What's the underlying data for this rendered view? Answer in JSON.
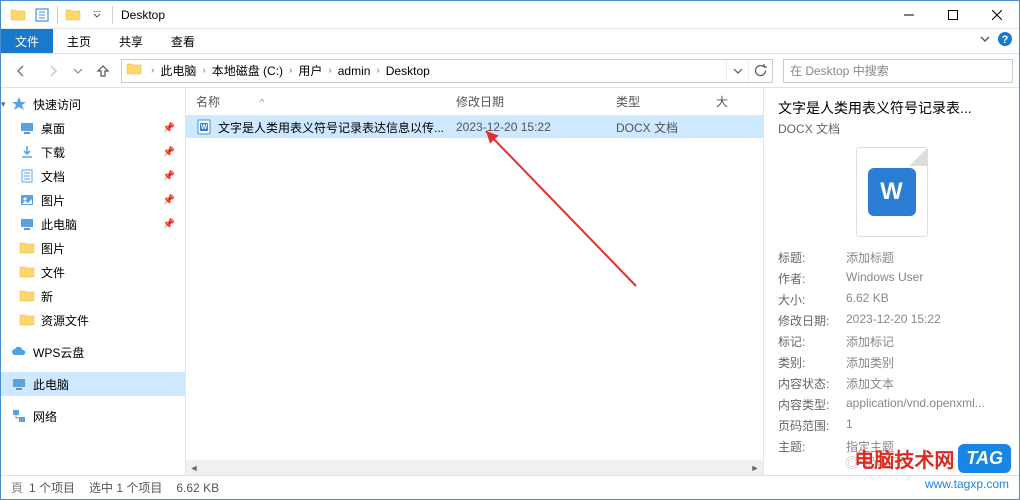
{
  "window": {
    "title": "Desktop"
  },
  "ribbon": {
    "file": "文件",
    "tabs": [
      "主页",
      "共享",
      "查看"
    ]
  },
  "address": {
    "crumbs": [
      "此电脑",
      "本地磁盘 (C:)",
      "用户",
      "admin",
      "Desktop"
    ]
  },
  "search": {
    "placeholder": "在 Desktop 中搜索"
  },
  "sidebar": {
    "quick_access": "快速访问",
    "quick_items": [
      {
        "label": "桌面",
        "pin": true,
        "icon": "desktop"
      },
      {
        "label": "下载",
        "pin": true,
        "icon": "download"
      },
      {
        "label": "文档",
        "pin": true,
        "icon": "doc"
      },
      {
        "label": "图片",
        "pin": true,
        "icon": "pic"
      },
      {
        "label": "此电脑",
        "pin": true,
        "icon": "pc"
      },
      {
        "label": "图片",
        "pin": false,
        "icon": "folder"
      },
      {
        "label": "文件",
        "pin": false,
        "icon": "folder"
      },
      {
        "label": "新",
        "pin": false,
        "icon": "folder"
      },
      {
        "label": "资源文件",
        "pin": false,
        "icon": "folder"
      }
    ],
    "wps": "WPS云盘",
    "this_pc": "此电脑",
    "network": "网络"
  },
  "columns": {
    "name": "名称",
    "date": "修改日期",
    "type": "类型",
    "size": "大"
  },
  "files": [
    {
      "name": "文字是人类用表义符号记录表达信息以传...",
      "date": "2023-12-20 15:22",
      "type": "DOCX 文档"
    }
  ],
  "preview": {
    "title": "文字是人类用表义符号记录表...",
    "subtitle": "DOCX 文档",
    "props": [
      {
        "label": "标题:",
        "value": "添加标题"
      },
      {
        "label": "作者:",
        "value": "Windows User"
      },
      {
        "label": "大小:",
        "value": "6.62 KB"
      },
      {
        "label": "修改日期:",
        "value": "2023-12-20 15:22"
      },
      {
        "label": "标记:",
        "value": "添加标记"
      },
      {
        "label": "类别:",
        "value": "添加类别"
      },
      {
        "label": "内容状态:",
        "value": "添加文本"
      },
      {
        "label": "内容类型:",
        "value": "application/vnd.openxml..."
      },
      {
        "label": "页码范围:",
        "value": "1"
      },
      {
        "label": "主题:",
        "value": "指定主题"
      }
    ]
  },
  "status": {
    "items": "1 个项目",
    "selected": "选中 1 个项目",
    "size": "6.62 KB"
  },
  "watermark": {
    "text1": "电脑技术网",
    "tag": "TAG",
    "url": "www.tagxp.com"
  }
}
